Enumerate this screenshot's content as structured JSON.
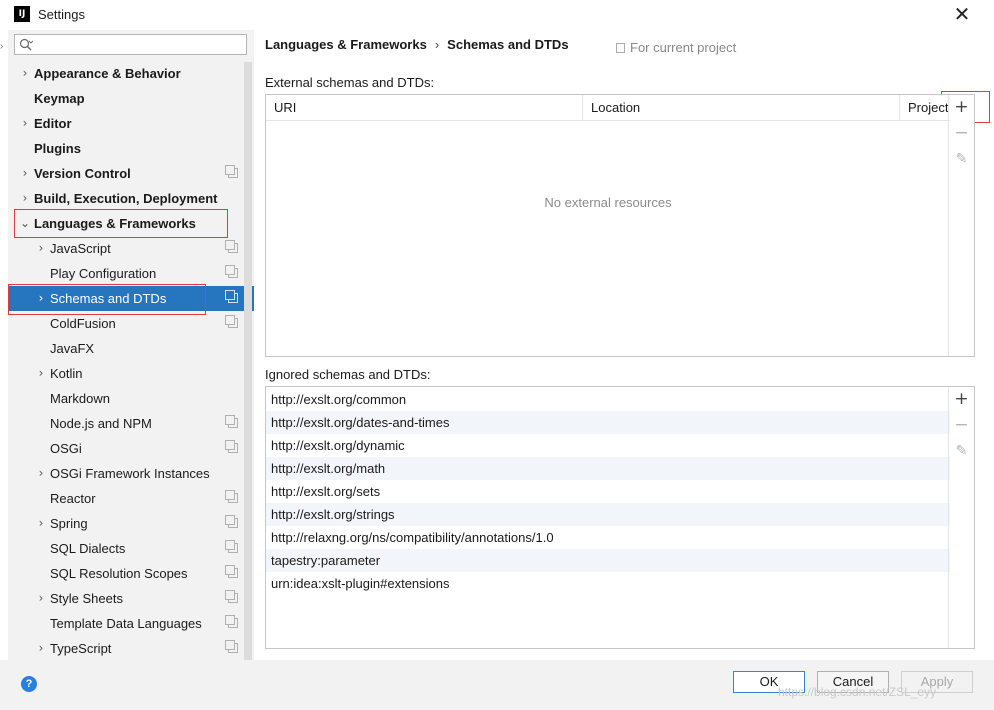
{
  "window": {
    "title": "Settings",
    "app_icon_text": "IJ"
  },
  "search": {
    "placeholder": ""
  },
  "sidebar": {
    "items": [
      {
        "label": "Appearance & Behavior",
        "level": 0,
        "bold": true,
        "arrow": "›"
      },
      {
        "label": "Keymap",
        "level": 0,
        "bold": true
      },
      {
        "label": "Editor",
        "level": 0,
        "bold": true,
        "arrow": "›"
      },
      {
        "label": "Plugins",
        "level": 0,
        "bold": true
      },
      {
        "label": "Version Control",
        "level": 0,
        "bold": true,
        "arrow": "›",
        "copy": true
      },
      {
        "label": "Build, Execution, Deployment",
        "level": 0,
        "bold": true,
        "arrow": "›"
      },
      {
        "label": "Languages & Frameworks",
        "level": 0,
        "bold": true,
        "arrow": "⌄"
      },
      {
        "label": "JavaScript",
        "level": 1,
        "arrow": "›",
        "copy": true
      },
      {
        "label": "Play Configuration",
        "level": 1,
        "copy": true
      },
      {
        "label": "Schemas and DTDs",
        "level": 1,
        "arrow": "›",
        "copy": true,
        "selected": true
      },
      {
        "label": "ColdFusion",
        "level": 1,
        "copy": true
      },
      {
        "label": "JavaFX",
        "level": 1
      },
      {
        "label": "Kotlin",
        "level": 1,
        "arrow": "›"
      },
      {
        "label": "Markdown",
        "level": 1
      },
      {
        "label": "Node.js and NPM",
        "level": 1,
        "copy": true
      },
      {
        "label": "OSGi",
        "level": 1,
        "copy": true
      },
      {
        "label": "OSGi Framework Instances",
        "level": 1,
        "arrow": "›"
      },
      {
        "label": "Reactor",
        "level": 1,
        "copy": true
      },
      {
        "label": "Spring",
        "level": 1,
        "arrow": "›",
        "copy": true
      },
      {
        "label": "SQL Dialects",
        "level": 1,
        "copy": true
      },
      {
        "label": "SQL Resolution Scopes",
        "level": 1,
        "copy": true
      },
      {
        "label": "Style Sheets",
        "level": 1,
        "arrow": "›",
        "copy": true
      },
      {
        "label": "Template Data Languages",
        "level": 1,
        "copy": true
      },
      {
        "label": "TypeScript",
        "level": 1,
        "arrow": "›",
        "copy": true
      }
    ]
  },
  "breadcrumb": {
    "parent": "Languages & Frameworks",
    "separator": "›",
    "current": "Schemas and DTDs"
  },
  "scope": {
    "label": "For current project"
  },
  "external": {
    "label": "External schemas and DTDs:",
    "columns": [
      "URI",
      "Location",
      "Project"
    ],
    "empty_text": "No external resources"
  },
  "ignored": {
    "label": "Ignored schemas and DTDs:",
    "rows": [
      "http://exslt.org/common",
      "http://exslt.org/dates-and-times",
      "http://exslt.org/dynamic",
      "http://exslt.org/math",
      "http://exslt.org/sets",
      "http://exslt.org/strings",
      "http://relaxng.org/ns/compatibility/annotations/1.0",
      "tapestry:parameter",
      "urn:idea:xslt-plugin#extensions"
    ]
  },
  "toolbar": {
    "add": "+",
    "remove": "−",
    "edit": "✎"
  },
  "footer": {
    "help": "?",
    "ok": "OK",
    "cancel": "Cancel",
    "apply": "Apply"
  },
  "watermark": "https://blog.csdn.net/ZSL_eyy",
  "colors": {
    "selection": "#2675bf",
    "highlight_box": "#e23b3b",
    "help": "#2a7de1"
  }
}
